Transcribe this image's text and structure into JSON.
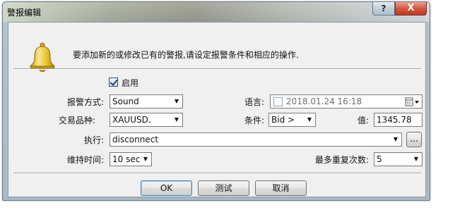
{
  "window": {
    "title": "警报编辑",
    "help_label": "?",
    "close_label": "X"
  },
  "header": {
    "instruction": "要添加新的或修改已有的警报,请设定报警条件和相应的操作."
  },
  "form": {
    "enabled": {
      "label": "启用",
      "checked": true
    },
    "alert_type": {
      "label": "报警方式:",
      "value": "Sound"
    },
    "language": {
      "label": "语言:",
      "checked": false,
      "value": "2018.01.24 16:18"
    },
    "symbol": {
      "label": "交易品种:",
      "value": "XAUUSD."
    },
    "condition": {
      "label": "条件:",
      "value": "Bid >"
    },
    "price": {
      "label": "值:",
      "value": "1345.78"
    },
    "action": {
      "label": "执行:",
      "value": "disconnect",
      "browse_label": "..."
    },
    "timeout": {
      "label": "维持时间:",
      "value": "10 sec"
    },
    "max_repeats": {
      "label": "最多重复次数:",
      "value": "5"
    }
  },
  "buttons": {
    "ok": "OK",
    "test": "测试",
    "cancel": "取消"
  },
  "colors": {
    "accent": "#3c7fb1",
    "close_button": "#c23a25",
    "bell": "#e8c02a"
  }
}
